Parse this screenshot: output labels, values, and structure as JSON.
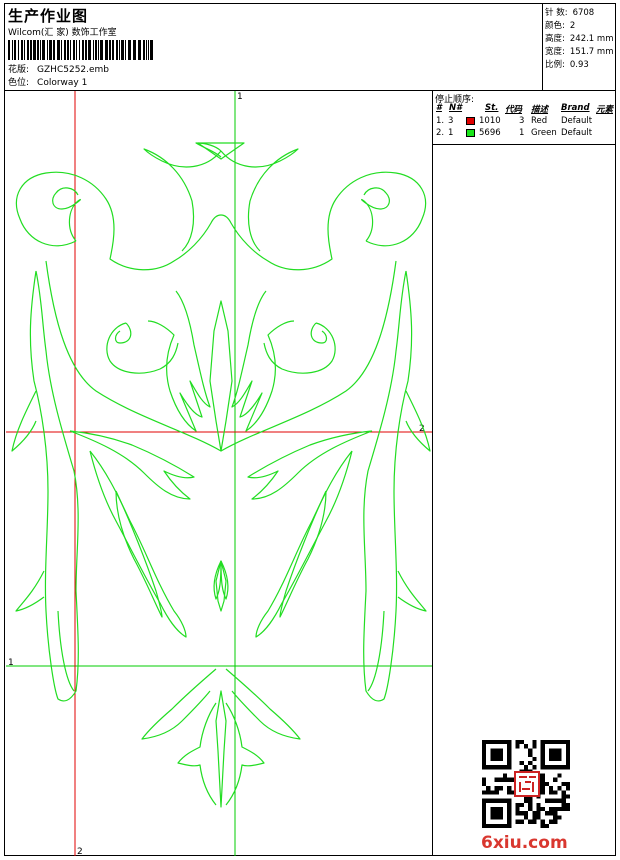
{
  "header": {
    "title": "生产作业图",
    "subtitle": "Wilcom(汇 家) 数饰工作室",
    "file_label": "花版:",
    "file_value": "GZHC5252.emb",
    "colorway_label": "色位:",
    "colorway_value": "Colorway 1"
  },
  "stats": {
    "stitches_label": "针 数:",
    "stitches_value": "6708",
    "colors_label": "颜色:",
    "colors_value": "2",
    "height_label": "高度:",
    "height_value": "242.1 mm",
    "width_label": "宽度:",
    "width_value": "151.7 mm",
    "scale_label": "比例:",
    "scale_value": "0.93"
  },
  "stop_sequence": {
    "heading": "停止顺序:",
    "columns": [
      "#",
      "N#",
      "St.",
      "代码",
      "描述",
      "Brand",
      "元素"
    ],
    "rows": [
      {
        "index": "1.",
        "n": "3",
        "color": "#e00000",
        "stitches": "1010",
        "code": "3",
        "desc": "Red",
        "brand": "Default"
      },
      {
        "index": "2.",
        "n": "1",
        "color": "#19e619",
        "stitches": "5696",
        "code": "1",
        "desc": "Green",
        "brand": "Default"
      }
    ]
  },
  "guides": {
    "green_vertical_label": "1",
    "red_horizontal_label": "2",
    "green_horizontal_label": "1",
    "red_vertical_label": "2"
  },
  "colors": {
    "outline": "#22dd22",
    "guide_red": "#e00000",
    "guide_green": "#00cc00",
    "logo": "#d9372f"
  },
  "watermark": {
    "text": "6xiu.com"
  }
}
